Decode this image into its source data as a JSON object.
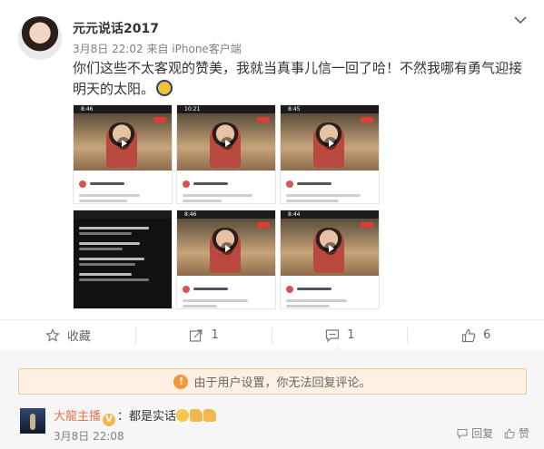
{
  "post": {
    "username": "元元说话2017",
    "meta": "3月8日 22:02 来自 iPhone客户端",
    "text": "你们这些不太客观的赞美，我就当真事儿信一回了哈！不然我哪有勇气迎接明天的太阳。",
    "emoji": "sun-emoji"
  },
  "thumbs": [
    {
      "status": "8:46"
    },
    {
      "status": "10:21"
    },
    {
      "status": "8:45"
    },
    {
      "status": ""
    },
    {
      "status": "8:46"
    },
    {
      "status": "8:44"
    }
  ],
  "actions": {
    "favorite_label": "收藏",
    "forward_count": "1",
    "comment_count": "1",
    "like_count": "6"
  },
  "comments": {
    "notice": "由于用户设置，你无法回复评论。",
    "items": [
      {
        "name": "大龍主播",
        "text": "：都是实话",
        "time": "3月8日 22:08",
        "reply_label": "回复",
        "like_label": "赞"
      }
    ]
  }
}
